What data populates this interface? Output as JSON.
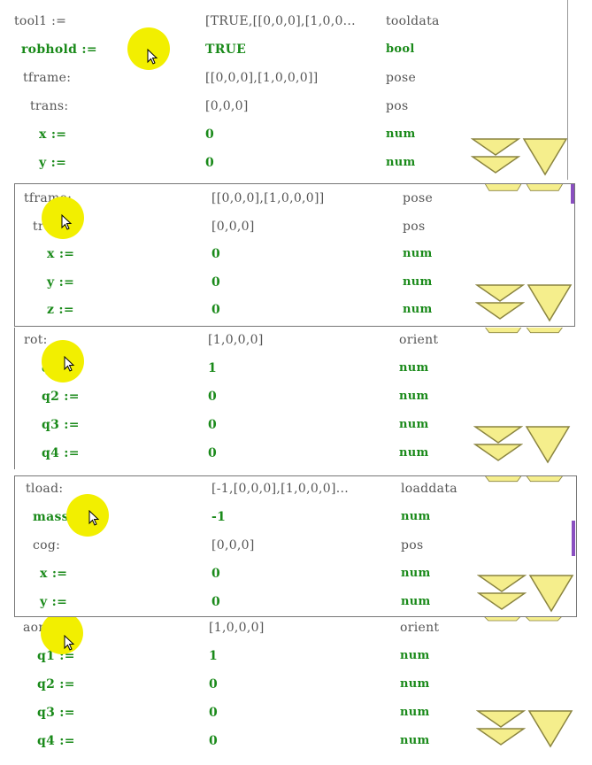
{
  "panels": [
    {
      "rows": [
        {
          "name": "tool1 :=",
          "value": "[TRUE,[[0,0,0],[1,0,0...",
          "type": "tooldata",
          "style": "gray"
        },
        {
          "name": "robhold :=",
          "value": "TRUE",
          "type": "bool",
          "style": "green"
        },
        {
          "name": "tframe:",
          "value": "[[0,0,0],[1,0,0,0]]",
          "type": "pose",
          "style": "gray"
        },
        {
          "name": "trans:",
          "value": "[0,0,0]",
          "type": "pos",
          "style": "gray"
        },
        {
          "name": "x :=",
          "value": "0",
          "type": "num",
          "style": "green"
        },
        {
          "name": "y :=",
          "value": "0",
          "type": "num",
          "style": "green"
        }
      ]
    },
    {
      "rows": [
        {
          "name": "tframe:",
          "value": "[[0,0,0],[1,0,0,0]]",
          "type": "pose",
          "style": "gray"
        },
        {
          "name": "trans:",
          "value": "[0,0,0]",
          "type": "pos",
          "style": "gray"
        },
        {
          "name": "x :=",
          "value": "0",
          "type": "num",
          "style": "green"
        },
        {
          "name": "y :=",
          "value": "0",
          "type": "num",
          "style": "green"
        },
        {
          "name": "z :=",
          "value": "0",
          "type": "num",
          "style": "green"
        }
      ]
    },
    {
      "rows": [
        {
          "name": "rot:",
          "value": "[1,0,0,0]",
          "type": "orient",
          "style": "gray"
        },
        {
          "name": "q1 :=",
          "value": "1",
          "type": "num",
          "style": "green"
        },
        {
          "name": "q2 :=",
          "value": "0",
          "type": "num",
          "style": "green"
        },
        {
          "name": "q3 :=",
          "value": "0",
          "type": "num",
          "style": "green"
        },
        {
          "name": "q4 :=",
          "value": "0",
          "type": "num",
          "style": "green"
        }
      ]
    },
    {
      "rows": [
        {
          "name": "tload:",
          "value": "[-1,[0,0,0],[1,0,0,0]...",
          "type": "loaddata",
          "style": "gray"
        },
        {
          "name": "mass :=",
          "value": "-1",
          "type": "num",
          "style": "green"
        },
        {
          "name": "cog:",
          "value": "[0,0,0]",
          "type": "pos",
          "style": "gray"
        },
        {
          "name": "x :=",
          "value": "0",
          "type": "num",
          "style": "green"
        },
        {
          "name": "y :=",
          "value": "0",
          "type": "num",
          "style": "green"
        }
      ]
    },
    {
      "rows": [
        {
          "name": "aom:",
          "value": "[1,0,0,0]",
          "type": "orient",
          "style": "gray"
        },
        {
          "name": "q1 :=",
          "value": "1",
          "type": "num",
          "style": "green"
        },
        {
          "name": "q2 :=",
          "value": "0",
          "type": "num",
          "style": "green"
        },
        {
          "name": "q3 :=",
          "value": "0",
          "type": "num",
          "style": "green"
        },
        {
          "name": "q4 :=",
          "value": "0",
          "type": "num",
          "style": "green"
        }
      ]
    }
  ],
  "colors": {
    "accent_green": "#1a8a1a",
    "highlight_yellow": "#f2ef00",
    "scroll_yellow": "#f5ee8c"
  },
  "icons": {
    "scroll_down": "double-chevron-down-icon",
    "page_down": "triangle-down-icon",
    "cursor": "mouse-pointer-icon"
  }
}
